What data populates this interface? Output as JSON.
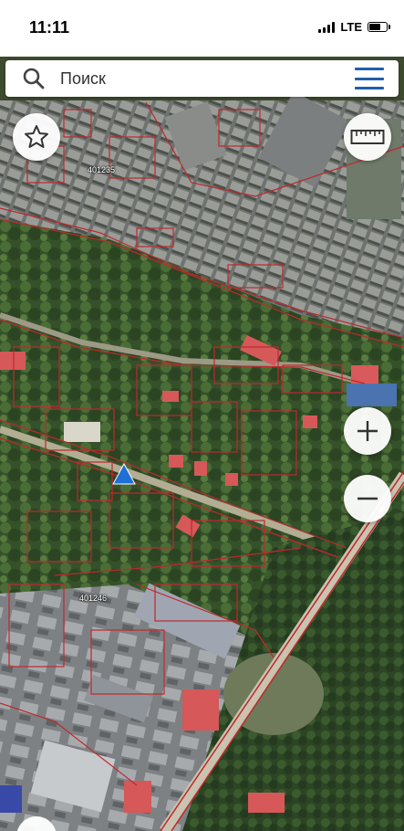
{
  "status_bar": {
    "time": "11:11",
    "network": "LTE",
    "battery_level": 0.7
  },
  "search": {
    "placeholder": "Поиск",
    "search_icon": "search-icon",
    "menu_icon": "hamburger-menu-icon"
  },
  "map": {
    "labels": [
      "401235",
      "401246"
    ],
    "zoom_in_label": "+",
    "zoom_out_label": "−",
    "colors": {
      "parcel_border": "#c0282d",
      "accent": "#1f5fa8",
      "marker": "#1f6fd6"
    }
  },
  "controls": {
    "favorite_icon": "star-icon",
    "ruler_icon": "ruler-icon",
    "zoom_in_icon": "plus-icon",
    "zoom_out_icon": "minus-icon",
    "location_icon": "navigation-arrow-icon"
  }
}
